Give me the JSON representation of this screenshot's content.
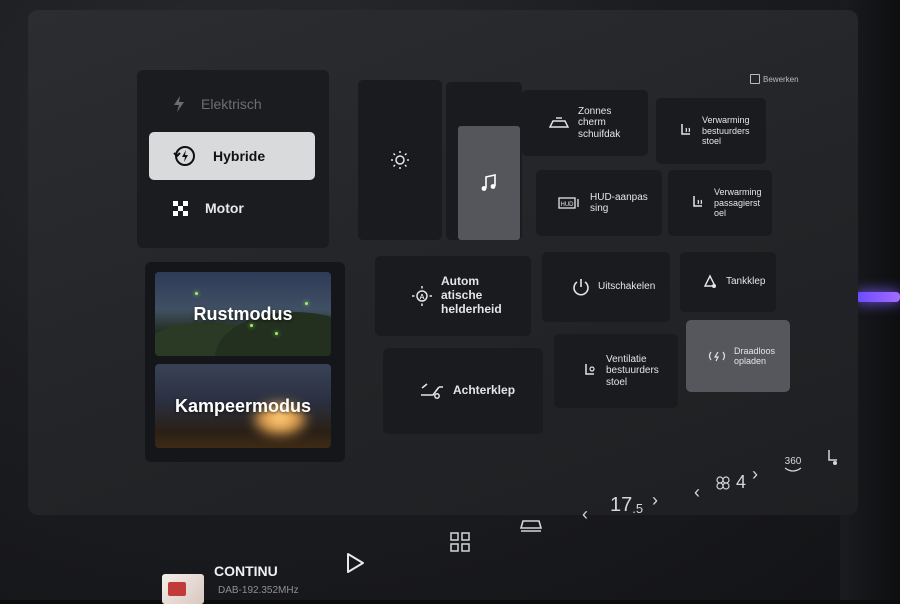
{
  "header": {
    "edit_label": "Bewerken"
  },
  "drive_modes": [
    {
      "label": "Elektrisch",
      "icon": "lightning-icon",
      "state": "dim"
    },
    {
      "label": "Hybride",
      "icon": "hybrid-cycle-icon",
      "state": "active"
    },
    {
      "label": "Motor",
      "icon": "checkered-flag-icon",
      "state": "normal"
    }
  ],
  "scenes": [
    {
      "label": "Rustmodus"
    },
    {
      "label": "Kampeermodus"
    }
  ],
  "tiles": {
    "brightness": {
      "icon": "sun-icon"
    },
    "music": {
      "icon": "music-note-icon"
    },
    "auto_brightness": {
      "label": "Autom\natische\nhelderheid",
      "icon": "auto-brightness-icon"
    },
    "tailgate": {
      "label": "Achterklep",
      "icon": "tailgate-icon"
    },
    "sunroof": {
      "label": "Zonnes\ncherm\nschuifdak",
      "icon": "sunroof-icon"
    },
    "driver_seat_heat": {
      "label": "Verwarming\nbestuurders\nstoel",
      "icon": "seat-heat-icon"
    },
    "hud": {
      "label": "HUD-aanpas\nsing",
      "icon": "hud-icon"
    },
    "passenger_seat_heat": {
      "label": "Verwarming\npassagierst\noel",
      "icon": "seat-heat-icon"
    },
    "power_off": {
      "label": "Uitschakelen",
      "icon": "power-icon"
    },
    "fuel_flap": {
      "label": "Tankklep",
      "icon": "fuel-flap-icon"
    },
    "driver_seat_vent": {
      "label": "Ventilatie\nbestuurders\nstoel",
      "icon": "seat-vent-icon"
    },
    "wireless_charging": {
      "label": "Draadloos\nopladen",
      "icon": "wireless-charge-icon"
    }
  },
  "bottom_bar": {
    "media_title": "CONTINU",
    "media_subtitle": "DAB-192.352MHz",
    "play_icon": "play-icon",
    "apps_icon": "apps-grid-icon",
    "car_icon": "car-icon",
    "temperature_main": "17",
    "temperature_decimal": ".5",
    "fan_level": "4",
    "fan_icon": "fan-icon",
    "camera_label": "360",
    "seat_icon": "seat-icon"
  }
}
